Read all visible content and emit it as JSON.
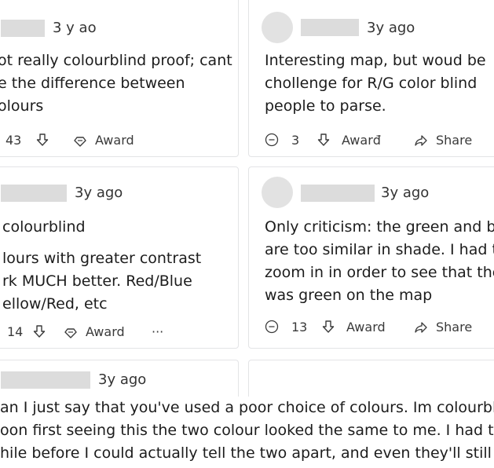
{
  "comments": [
    {
      "time": "3 y ao",
      "lines": [
        "ot really colourblind proof; cant",
        "e the difference between",
        "olours"
      ],
      "votes": "43",
      "award": "Award",
      "share": ""
    },
    {
      "time": "3y ago",
      "lines": [
        "Interesting map, but woud be",
        "chollenge for R/G color blind",
        "people to parse."
      ],
      "votes": "3",
      "award": "Awarđ",
      "share": "Share"
    },
    {
      "time": "3y ago",
      "lines": [
        "colourblind",
        "lours with greater contrast",
        "rk MUCH better. Red/Blue",
        "ellow/Red, etc"
      ],
      "votes": "14",
      "award": "Award",
      "more": "···"
    },
    {
      "time": "3y ago",
      "lines": [
        "Only criticism: the green and b",
        "are too similar in shade. I had te",
        "zoom in in order to see that the",
        "was green on the map"
      ],
      "votes": "13",
      "award": "Award",
      "share": "Share"
    },
    {
      "time": "3y ago",
      "lines": [
        "an I just say that you've used a poor choice of colours. Im colourblind",
        "oon first seeing this the two colour looked the same to me. I had to lo",
        "hile before I could actually tell the two apart, and even they'll still very s"
      ]
    }
  ]
}
